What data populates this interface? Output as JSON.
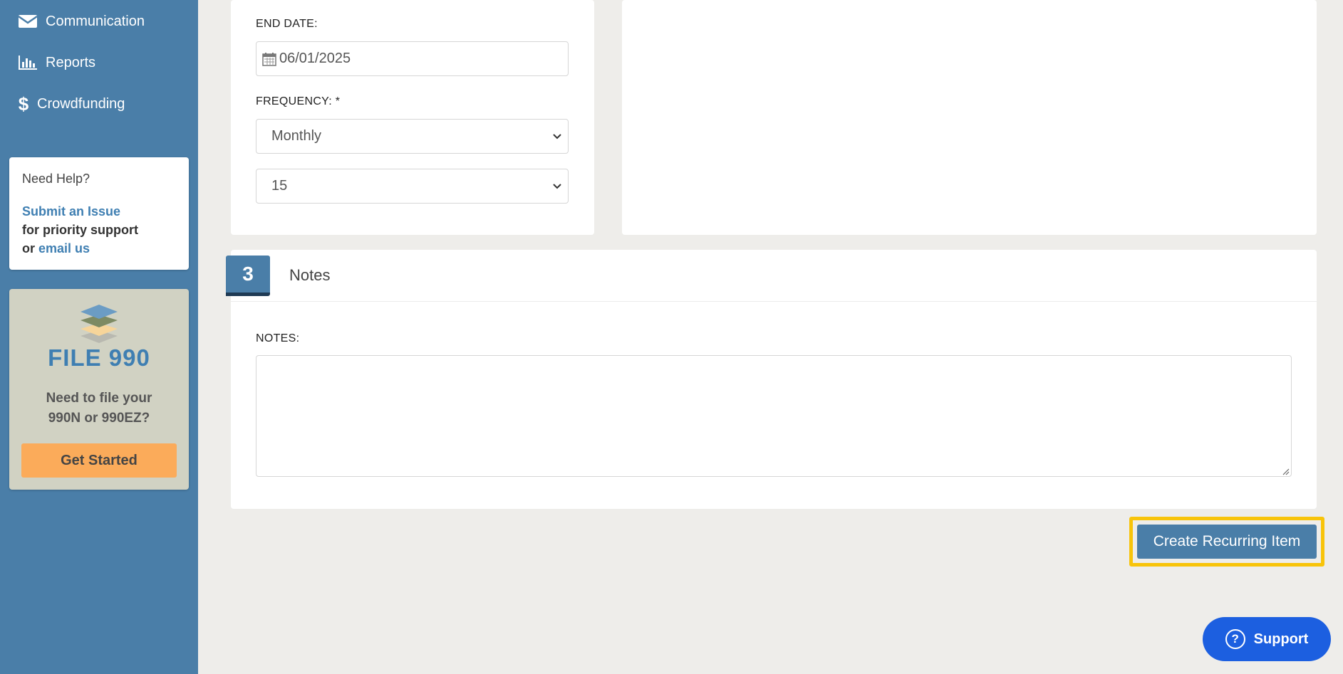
{
  "sidebar": {
    "nav": [
      {
        "label": "Communication",
        "icon": "envelope-icon"
      },
      {
        "label": "Reports",
        "icon": "bar-chart-icon"
      },
      {
        "label": "Crowdfunding",
        "icon": "dollar-icon"
      }
    ],
    "help": {
      "heading": "Need Help?",
      "submit_link": "Submit an Issue",
      "priority_text": "for priority support",
      "or_text": "or",
      "email_link": "email us"
    },
    "promo": {
      "title": "FILE 990",
      "line1": "Need to file your",
      "line2": "990N or 990EZ?",
      "button": "Get Started"
    }
  },
  "schedule": {
    "end_date_label": "END DATE:",
    "end_date_value": "06/01/2025",
    "frequency_label": "FREQUENCY: *",
    "frequency_value": "Monthly",
    "day_value": "15"
  },
  "notes_section": {
    "step_number": "3",
    "title": "Notes",
    "notes_label": "NOTES:",
    "notes_value": ""
  },
  "actions": {
    "create_label": "Create Recurring Item",
    "support_label": "Support",
    "support_icon_glyph": "?"
  },
  "colors": {
    "sidebar": "#4a7ea8",
    "primary": "#4a7ea8",
    "highlight": "#f8c40a",
    "promo_button": "#fbab5a",
    "support": "#1c5fe0"
  }
}
